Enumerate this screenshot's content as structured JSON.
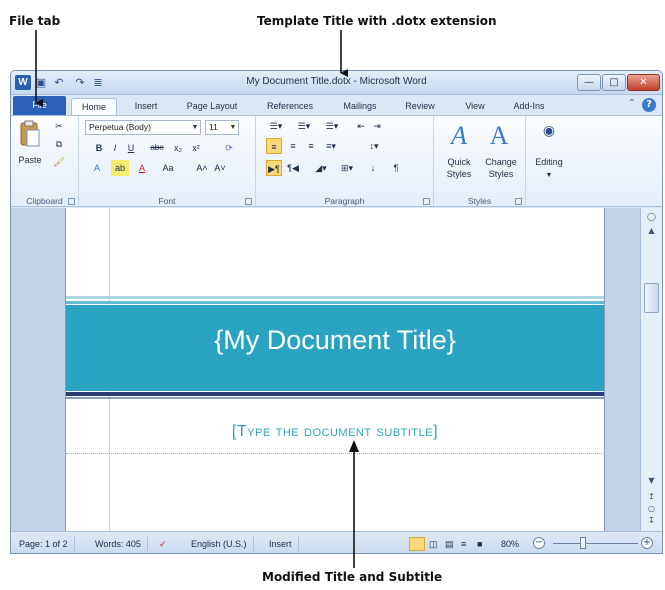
{
  "annotations": {
    "file_tab": "File tab",
    "template_title": "Template Title with .dotx extension",
    "modified": "Modified Title and Subtitle"
  },
  "window": {
    "title": "My Document Title.dotx  -  Microsoft Word",
    "app_icon": "W",
    "minimize_icon": "minimize-icon",
    "maximize_icon": "maximize-icon",
    "close_icon": "close-icon"
  },
  "qat": {
    "save": "💾",
    "undo": "↶",
    "redo": "↷",
    "more": "≣"
  },
  "tabs": {
    "file": "File",
    "items": [
      "Home",
      "Insert",
      "Page Layout",
      "References",
      "Mailings",
      "Review",
      "View",
      "Add-Ins"
    ]
  },
  "ribbon": {
    "clipboard": {
      "label": "Clipboard",
      "paste": "Paste"
    },
    "font": {
      "label": "Font",
      "font_name": "Perpetua (Body)",
      "font_size": "11",
      "bold": "B",
      "italic": "I",
      "underline": "U",
      "strike": "abe",
      "subscript": "x₂",
      "superscript": "x²",
      "grow": "A˄",
      "shrink": "A˅",
      "case": "Aa",
      "fontcolor": "A"
    },
    "paragraph": {
      "label": "Paragraph",
      "pilcrow": "¶",
      "sort": "↓"
    },
    "styles": {
      "label": "Styles",
      "quick": "Quick",
      "quick2": "Styles",
      "change": "Change",
      "change2": "Styles"
    },
    "editing": {
      "label": "Editing"
    }
  },
  "document": {
    "title": "{My Document Title}",
    "subtitle": "[Type the document subtitle]",
    "accent": "#2aa3c3"
  },
  "status": {
    "page": "Page: 1 of 2",
    "words": "Words: 405",
    "language": "English (U.S.)",
    "mode": "Insert",
    "zoom": "80%",
    "zoom_fraction": 0.35,
    "minus": "−",
    "plus": "+"
  }
}
